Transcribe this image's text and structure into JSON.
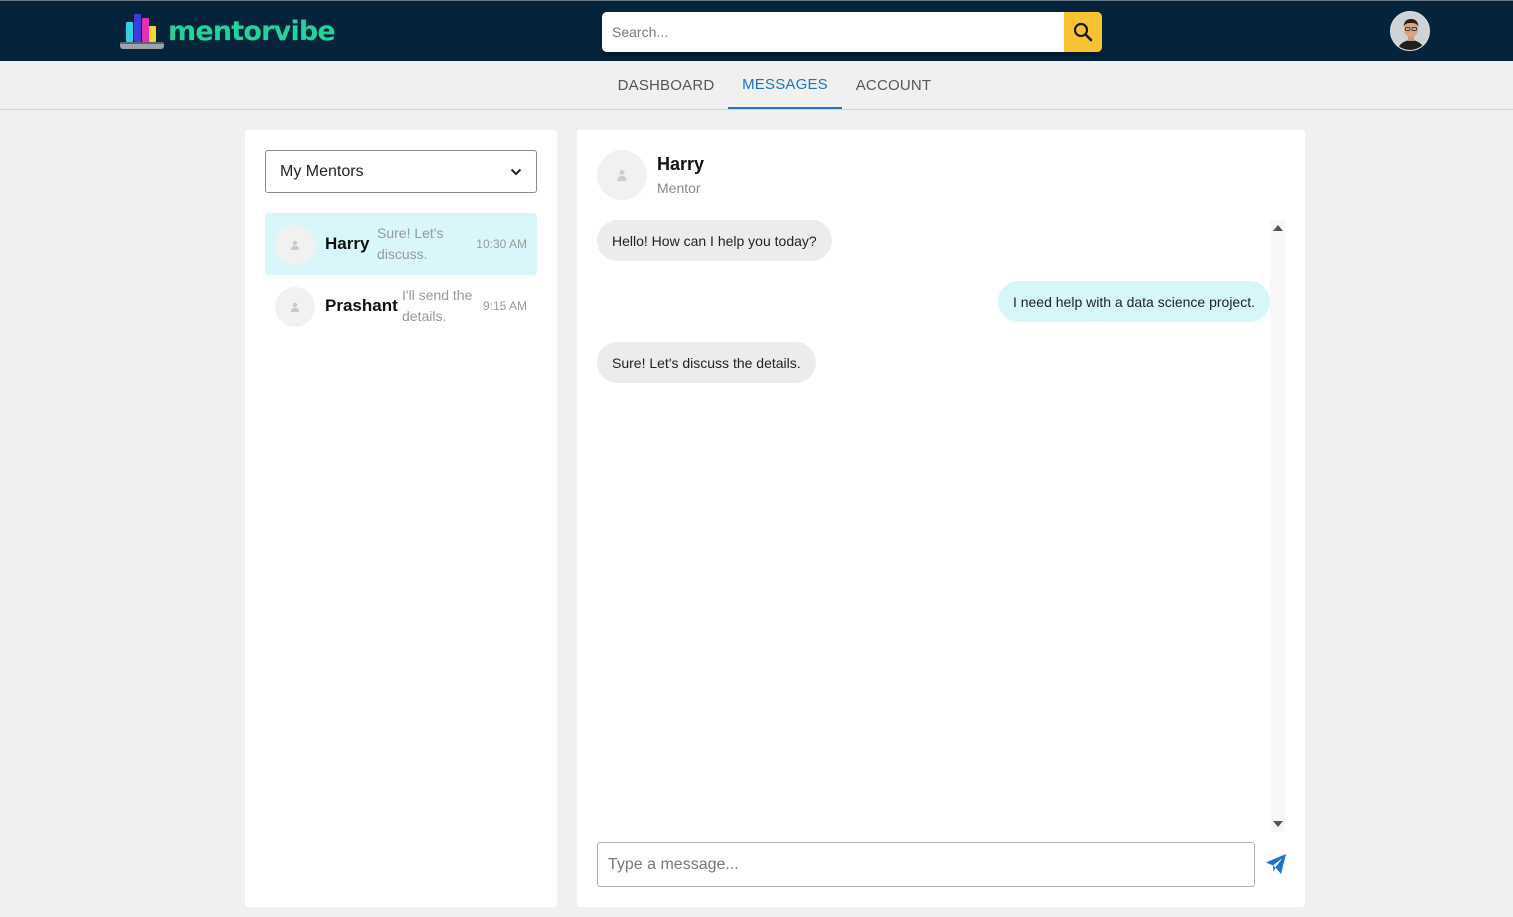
{
  "header": {
    "brand": "mentorvibe",
    "brand_color": "#22d39a",
    "search_placeholder": "Search...",
    "search_icon": "search-icon",
    "avatar_icon": "user-avatar"
  },
  "nav": {
    "tabs": [
      {
        "label": "DASHBOARD",
        "active": false
      },
      {
        "label": "MESSAGES",
        "active": true
      },
      {
        "label": "ACCOUNT",
        "active": false
      }
    ]
  },
  "conversations": {
    "filter_selected": "My Mentors",
    "items": [
      {
        "name": "Harry",
        "snippet": "Sure! Let's discuss.",
        "time": "10:30 AM",
        "active": true
      },
      {
        "name": "Prashant",
        "snippet": "I'll send the details.",
        "time": "9:15 AM",
        "active": false
      }
    ]
  },
  "chat": {
    "name": "Harry",
    "role": "Mentor",
    "messages": [
      {
        "direction": "incoming",
        "text": "Hello! How can I help you today?"
      },
      {
        "direction": "outgoing",
        "text": "I need help with a data science project."
      },
      {
        "direction": "incoming",
        "text": "Sure! Let's discuss the details."
      }
    ],
    "input_placeholder": "Type a message...",
    "send_icon": "send-icon"
  },
  "colors": {
    "topbar": "#05243b",
    "search_button": "#f8c232",
    "active_tab": "#1e73c8",
    "active_conversation": "#d9f7fa",
    "outgoing_bubble": "#d6f6f9",
    "incoming_bubble": "#ececec",
    "send_icon": "#1e73c8"
  }
}
